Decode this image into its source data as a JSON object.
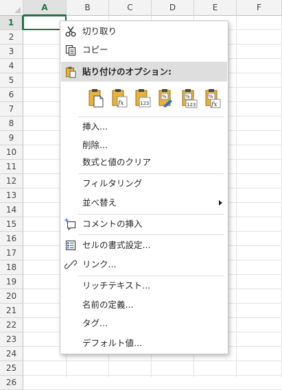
{
  "sheet": {
    "columns": [
      "A",
      "B",
      "C",
      "D",
      "E",
      "F"
    ],
    "active_column": "A",
    "rows": [
      "1",
      "2",
      "3",
      "4",
      "5",
      "6",
      "7",
      "8",
      "9",
      "10",
      "11",
      "12",
      "13",
      "14",
      "15",
      "16",
      "17",
      "18",
      "19",
      "20",
      "21",
      "22",
      "23",
      "24",
      "25",
      "26"
    ],
    "active_row": "1",
    "accent_color": "#217346"
  },
  "context_menu": {
    "cut": "切り取り",
    "copy": "コピー",
    "paste_options_header": "貼り付けのオプション:",
    "paste_options": [
      {
        "icon": "paste-icon"
      },
      {
        "icon": "paste-formulas-icon"
      },
      {
        "icon": "paste-values-icon"
      },
      {
        "icon": "paste-formatting-icon"
      },
      {
        "icon": "paste-values-number-format-icon"
      },
      {
        "icon": "paste-formulas-number-format-icon"
      }
    ],
    "insert": "挿入...",
    "delete": "削除...",
    "clear_contents": "数式と値のクリア",
    "filter": "フィルタリング",
    "sort": "並べ替え",
    "insert_comment": "コメントの挿入",
    "format_cells": "セルの書式設定...",
    "link": "リンク...",
    "rich_text": "リッチテキスト...",
    "define_name": "名前の定義...",
    "tag": "タグ...",
    "default_value": "デフォルト値..."
  }
}
